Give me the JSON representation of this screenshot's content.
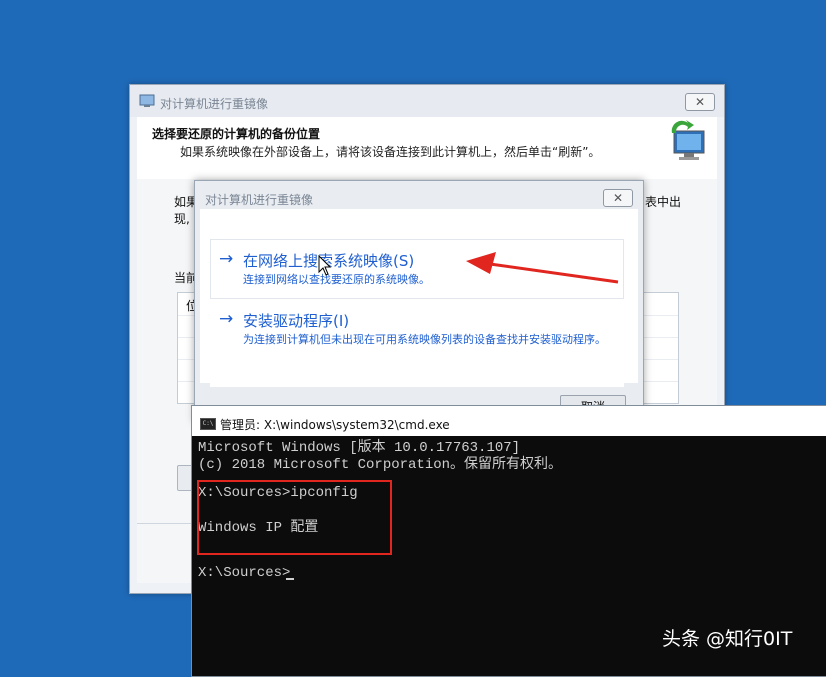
{
  "main_dialog": {
    "title": "对计算机进行重镜像",
    "heading": "选择要还原的计算机的备份位置",
    "subheading": "如果系统映像在外部设备上，请将该设备连接到此计算机上，然后单击“刷新”。",
    "fragment_left_1": "如果",
    "fragment_left_2": "现,",
    "fragment_right": "表中出",
    "fragment_current": "当前",
    "list_header_frag": "位",
    "close_glyph": "✕"
  },
  "inner_dialog": {
    "title": "对计算机进行重镜像",
    "close_glyph": "✕",
    "options": [
      {
        "arrow": "→",
        "title": "在网络上搜索系统映像(S)",
        "desc": "连接到网络以查找要还原的系统映像。"
      },
      {
        "arrow": "→",
        "title": "安装驱动程序(I)",
        "desc": "为连接到计算机但未出现在可用系统映像列表的设备查找并安装驱动程序。"
      }
    ],
    "cancel_label": "取消"
  },
  "cmd": {
    "title": "管理员: X:\\windows\\system32\\cmd.exe",
    "icon_text": "C:\\",
    "lines": [
      "Microsoft Windows [版本 10.0.17763.107]",
      "(c) 2018 Microsoft Corporation。保留所有权利。",
      "X:\\Sources>ipconfig",
      "Windows IP 配置",
      "X:\\Sources>"
    ]
  },
  "watermark": "头条 @知行0IT",
  "colors": {
    "desktop": "#1f6ab8",
    "link": "#1f5fd1",
    "annotation": "#e0261f"
  },
  "icons": [
    "restore-icon",
    "window-icon",
    "cmd-icon",
    "mouse-pointer-icon",
    "annotation-arrow-icon"
  ]
}
